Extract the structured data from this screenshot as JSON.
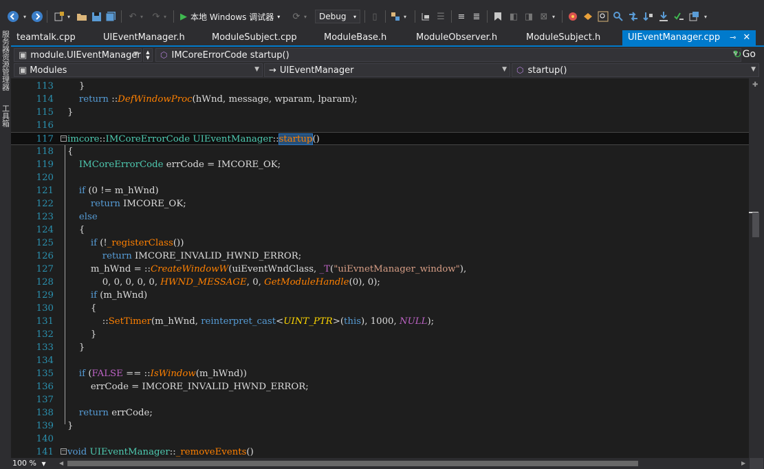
{
  "toolbar": {
    "run_label": "本地 Windows 调试器",
    "config_value": "Debug"
  },
  "left_strip": {
    "item1": "服务器资源管理器",
    "item2": "工具箱"
  },
  "tabs": [
    {
      "label": "teamtalk.cpp"
    },
    {
      "label": "UIEventManager.h"
    },
    {
      "label": "ModuleSubject.cpp"
    },
    {
      "label": "ModuleBase.h"
    },
    {
      "label": "ModuleObserver.h"
    },
    {
      "label": "ModuleSubject.h"
    },
    {
      "label": "UIEventManager.cpp"
    }
  ],
  "nav": {
    "project": "module.UIEventManager",
    "function_member": "IMCoreErrorCode startup()",
    "go_label": "Go",
    "scope": "Modules",
    "class": "UIEventManager",
    "member": "startup()"
  },
  "editor": {
    "line_numbers": [
      "113",
      "114",
      "115",
      "116",
      "117",
      "118",
      "119",
      "120",
      "121",
      "122",
      "123",
      "124",
      "125",
      "126",
      "127",
      "128",
      "129",
      "130",
      "131",
      "132",
      "133",
      "134",
      "135",
      "136",
      "137",
      "138",
      "139",
      "140",
      "141"
    ]
  },
  "status": {
    "zoom": "100 %"
  }
}
